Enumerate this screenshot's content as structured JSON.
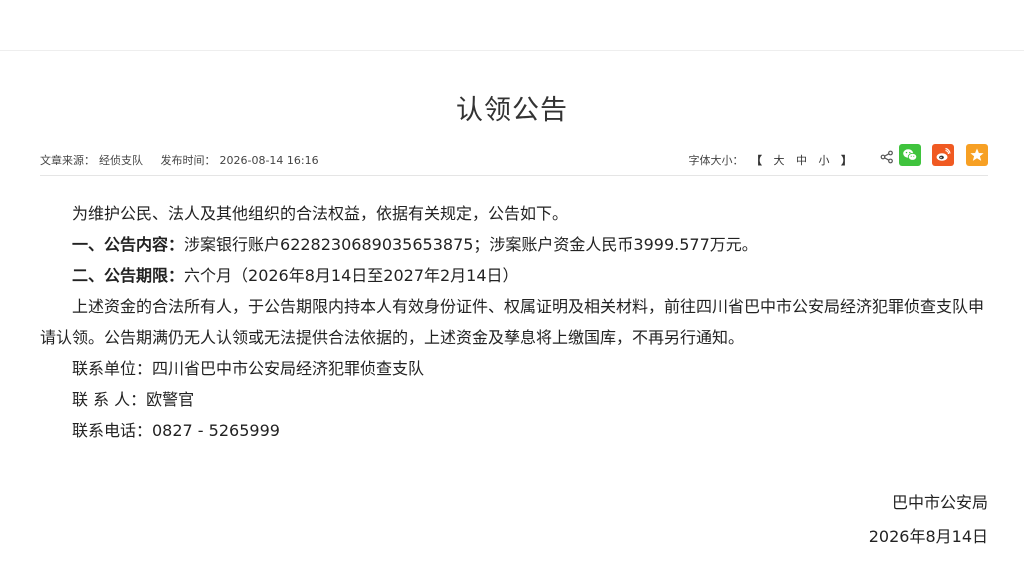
{
  "title": "认领公告",
  "meta": {
    "source_label": "文章来源：",
    "source_value": "经侦支队",
    "publish_label": "发布时间：",
    "publish_value": "2026-08-14 16:16",
    "font_size_label": "字体大小：",
    "bracket_open": "【",
    "size_large": "大",
    "size_medium": "中",
    "size_small": "小",
    "bracket_close": "】"
  },
  "share": {
    "icons": [
      "share-icon",
      "wechat-icon",
      "weibo-icon",
      "star-icon"
    ],
    "colors": {
      "wechat": "#3fc33d",
      "weibo": "#f05a22",
      "favorite": "#f7a024"
    }
  },
  "body": {
    "intro": "为维护公民、法人及其他组织的合法权益，依据有关规定，公告如下。",
    "item1_heading": "一、公告内容：",
    "item1_text": "涉案银行账户6228230689035653875；涉案账户资金人民币3999.577万元。",
    "item2_heading": "二、公告期限：",
    "item2_text": "六个月（2026年8月14日至2027年2月14日）",
    "paragraph": "上述资金的合法所有人，于公告期限内持本人有效身份证件、权属证明及相关材料，前往四川省巴中市公安局经济犯罪侦查支队申请认领。公告期满仍无人认领或无法提供合法依据的，上述资金及孳息将上缴国库，不再另行通知。",
    "contact_unit": "联系单位：四川省巴中市公安局经济犯罪侦查支队",
    "contact_person": "联 系 人：欧警官",
    "contact_phone": "联系电话：0827 - 5265999"
  },
  "signature": {
    "org": "巴中市公安局",
    "date": "2026年8月14日"
  }
}
